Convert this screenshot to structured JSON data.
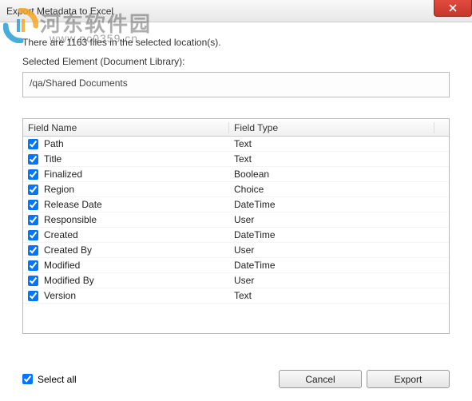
{
  "title": "Export Metadata to Excel",
  "info_text": "There are 1163 files in the selected location(s).",
  "selected_label": "Selected Element (Document Library):",
  "path_value": "/qa/Shared Documents",
  "columns": {
    "name": "Field Name",
    "type": "Field Type"
  },
  "rows": [
    {
      "checked": true,
      "name": "Path",
      "type": "Text"
    },
    {
      "checked": true,
      "name": "Title",
      "type": "Text"
    },
    {
      "checked": true,
      "name": "Finalized",
      "type": "Boolean"
    },
    {
      "checked": true,
      "name": "Region",
      "type": "Choice"
    },
    {
      "checked": true,
      "name": "Release Date",
      "type": "DateTime"
    },
    {
      "checked": true,
      "name": "Responsible",
      "type": "User"
    },
    {
      "checked": true,
      "name": "Created",
      "type": "DateTime"
    },
    {
      "checked": true,
      "name": "Created By",
      "type": "User"
    },
    {
      "checked": true,
      "name": "Modified",
      "type": "DateTime"
    },
    {
      "checked": true,
      "name": "Modified By",
      "type": "User"
    },
    {
      "checked": true,
      "name": "Version",
      "type": "Text"
    }
  ],
  "select_all": {
    "label": "Select all",
    "checked": true
  },
  "buttons": {
    "cancel": "Cancel",
    "export": "Export"
  },
  "watermark": {
    "text1": "河东软件园",
    "text2": "www.pc0359.cn"
  }
}
